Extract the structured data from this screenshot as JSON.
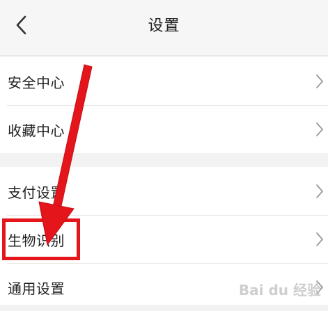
{
  "header": {
    "back_icon": "chevron-left-icon",
    "title": "设置"
  },
  "groups": [
    {
      "items": [
        {
          "label": "安全中心",
          "icon": "chevron-right-icon"
        },
        {
          "label": "收藏中心",
          "icon": "chevron-right-icon"
        }
      ]
    },
    {
      "items": [
        {
          "label": "支付设置",
          "icon": "chevron-right-icon"
        },
        {
          "label": "生物识别",
          "icon": "chevron-right-icon"
        },
        {
          "label": "通用设置",
          "icon": "chevron-right-icon"
        }
      ]
    }
  ],
  "annotation": {
    "highlight_color": "#e4151b",
    "highlighted_item": "生物识别"
  },
  "watermark": "Bai du 经验"
}
